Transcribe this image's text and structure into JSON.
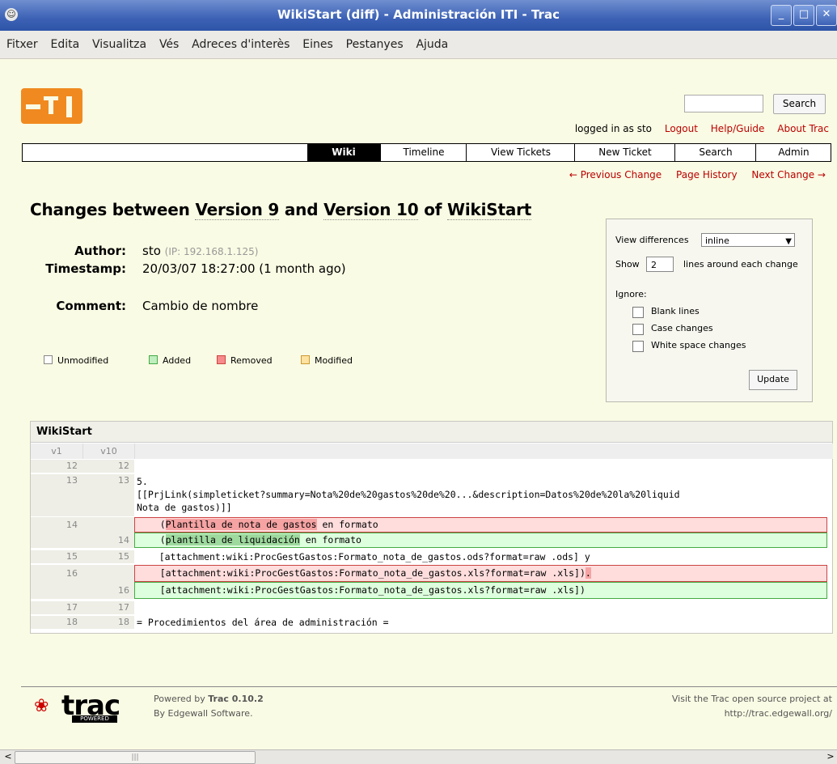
{
  "window": {
    "title": "WikiStart (diff) - Administración ITI - Trac"
  },
  "menu": [
    "Fitxer",
    "Edita",
    "Visualitza",
    "Vés",
    "Adreces d'interès",
    "Eines",
    "Pestanyes",
    "Ajuda"
  ],
  "search": {
    "button": "Search"
  },
  "metanav": {
    "logged_in": "logged in as sto",
    "logout": "Logout",
    "help": "Help/Guide",
    "about": "About Trac"
  },
  "mainnav": [
    "Wiki",
    "Timeline",
    "View Tickets",
    "New Ticket",
    "Search",
    "Admin"
  ],
  "ctxtnav": [
    "← Previous Change",
    "Page History",
    "Next Change →"
  ],
  "title": {
    "prefix": "Changes between ",
    "v9": "Version 9",
    "mid": " and ",
    "v10": "Version 10",
    "of": " of ",
    "page": "WikiStart"
  },
  "props": {
    "author_label": "Author:",
    "author": "sto",
    "ip": "(IP: 192.168.1.125)",
    "timestamp_label": "Timestamp:",
    "timestamp": "20/03/07 18:27:00 (1 month ago)",
    "comment_label": "Comment:",
    "comment": "Cambio de nombre"
  },
  "legend": [
    "Unmodified",
    "Added",
    "Removed",
    "Modified"
  ],
  "legend_colors": {
    "unmodified": "#ffffff",
    "added": "#bfeebf",
    "removed": "#f78a8a",
    "modified": "#fde2a0"
  },
  "prefs": {
    "view_label": "View differences",
    "view_value": "inline",
    "show_label": "Show",
    "show_value": "2",
    "lines_label": "lines around each change",
    "ignore_label": "Ignore:",
    "blank": "Blank lines",
    "case": "Case changes",
    "ws": "White space changes",
    "update": "Update"
  },
  "diff": {
    "title": "WikiStart",
    "col_v1": "v1",
    "col_v10": "v10",
    "r1": {
      "a": "12",
      "b": "12",
      "text": ""
    },
    "r2": {
      "a": "13",
      "b": "13",
      "text": "5.",
      "text2": "[[PrjLink(simpleticket?summary=Nota%20de%20gastos%20de%20...&description=Datos%20de%20la%20liquid",
      "text3": "Nota de gastos)]]"
    },
    "r3": {
      "a": "14",
      "pre": "    (",
      "hl": "Plantilla de nota de gastos",
      "post": " en formato"
    },
    "r4": {
      "b": "14",
      "pre": "    (",
      "hl": "plantilla de liquidación",
      "post": " en formato"
    },
    "r5": {
      "a": "15",
      "b": "15",
      "text": "    [attachment:wiki:ProcGestGastos:Formato_nota_de_gastos.ods?format=raw .ods] y"
    },
    "r6": {
      "a": "16",
      "pre": "    [attachment:wiki:ProcGestGastos:Formato_nota_de_gastos.xls?format=raw .xls])",
      "hl": "."
    },
    "r7": {
      "b": "16",
      "text": "    [attachment:wiki:ProcGestGastos:Formato_nota_de_gastos.xls?format=raw .xls])"
    },
    "r8": {
      "a": "17",
      "b": "17",
      "text": ""
    },
    "r9": {
      "a": "18",
      "b": "18",
      "text": "= Procedimientos del área de administración ="
    }
  },
  "footer": {
    "logo_word": "trac",
    "logo_powered": "POWERED",
    "powered_pre": "Powered by ",
    "powered_bold": "Trac 0.10.2",
    "by": "By Edgewall Software.",
    "visit": "Visit the Trac open source project at",
    "url": "http://trac.edgewall.org/"
  }
}
